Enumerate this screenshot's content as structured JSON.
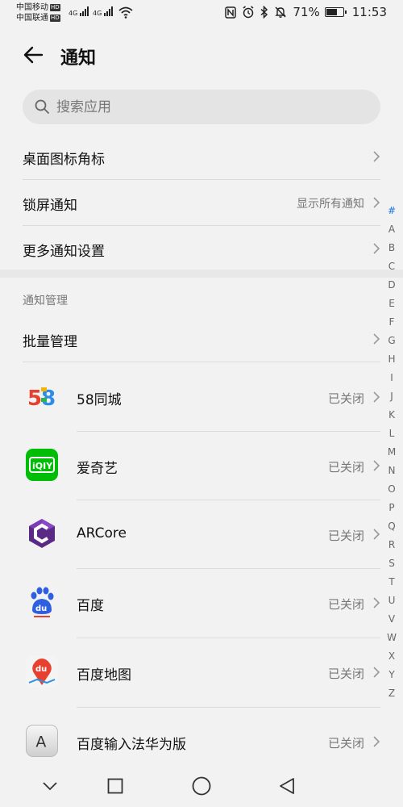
{
  "status_bar": {
    "carrier1": "中国移动",
    "carrier2": "中国联通",
    "hd": "HD",
    "network1": "4G",
    "network2": "4G",
    "battery": "71%",
    "battery_level": 0.71,
    "time": "11:53",
    "icons": [
      "nfc-icon",
      "alarm-icon",
      "bluetooth-icon",
      "bell-off-icon"
    ]
  },
  "header": {
    "title": "通知",
    "back_icon": "arrow-left-icon"
  },
  "search": {
    "placeholder": "搜索应用",
    "value": "",
    "icon": "search-icon"
  },
  "settings": [
    {
      "label": "桌面图标角标",
      "value": ""
    },
    {
      "label": "锁屏通知",
      "value": "显示所有通知"
    },
    {
      "label": "更多通知设置",
      "value": ""
    }
  ],
  "management": {
    "section_label": "通知管理",
    "batch_label": "批量管理",
    "apps": [
      {
        "name": "58同城",
        "status": "已关闭",
        "icon": "app-58-icon"
      },
      {
        "name": "爱奇艺",
        "status": "已关闭",
        "icon": "app-iqiyi-icon"
      },
      {
        "name": "ARCore",
        "status": "已关闭",
        "icon": "app-arcore-icon"
      },
      {
        "name": "百度",
        "status": "已关闭",
        "icon": "app-baidu-icon"
      },
      {
        "name": "百度地图",
        "status": "已关闭",
        "icon": "app-baidu-map-icon"
      },
      {
        "name": "百度输入法华为版",
        "status": "已关闭",
        "icon": "app-baidu-input-icon"
      }
    ]
  },
  "alphabet_index": [
    "#",
    "A",
    "B",
    "C",
    "D",
    "E",
    "F",
    "G",
    "H",
    "I",
    "J",
    "K",
    "L",
    "M",
    "N",
    "O",
    "P",
    "Q",
    "R",
    "S",
    "T",
    "U",
    "V",
    "W",
    "X",
    "Y",
    "Z"
  ],
  "nav_bar": [
    "chevron-down-icon",
    "recent-apps-icon",
    "home-icon",
    "back-icon"
  ],
  "colors": {
    "accent": "#1a73e8",
    "background": "#f2f2f2",
    "secondary_text": "#777777"
  }
}
